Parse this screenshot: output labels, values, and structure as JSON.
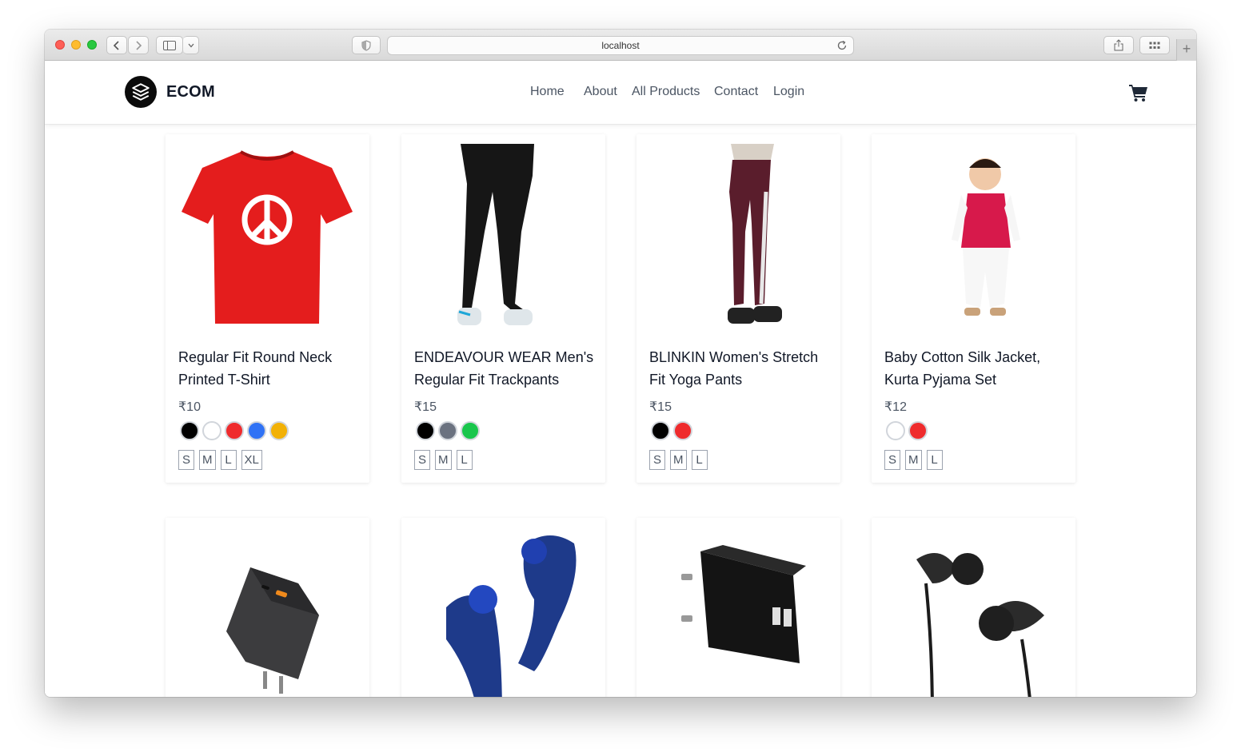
{
  "browser": {
    "url": "localhost"
  },
  "navbar": {
    "brand": "ECOM",
    "links": [
      "Home",
      "About",
      "All Products",
      "Contact",
      "Login"
    ]
  },
  "products": [
    {
      "title": "Regular Fit Round Neck Printed T-Shirt",
      "price": "₹10",
      "colors": [
        "#000000",
        "#ffffff",
        "#ef2b2d",
        "#2f72f5",
        "#f2b107"
      ],
      "sizes": [
        "S",
        "M",
        "L",
        "XL"
      ]
    },
    {
      "title": "ENDEAVOUR WEAR Men's Regular Fit Trackpants",
      "price": "₹15",
      "colors": [
        "#000000",
        "#6b7280",
        "#19c64c"
      ],
      "sizes": [
        "S",
        "M",
        "L"
      ]
    },
    {
      "title": "BLINKIN Women's Stretch Fit Yoga Pants",
      "price": "₹15",
      "colors": [
        "#000000",
        "#ef2b2d"
      ],
      "sizes": [
        "S",
        "M",
        "L"
      ]
    },
    {
      "title": "Baby Cotton Silk Jacket, Kurta Pyjama Set",
      "price": "₹12",
      "colors": [
        "#ffffff",
        "#ef2b2d"
      ],
      "sizes": [
        "S",
        "M",
        "L"
      ]
    }
  ],
  "more_products": [
    "charger-image",
    "earbuds-image",
    "ptron-adapter-image",
    "earphones-image"
  ]
}
